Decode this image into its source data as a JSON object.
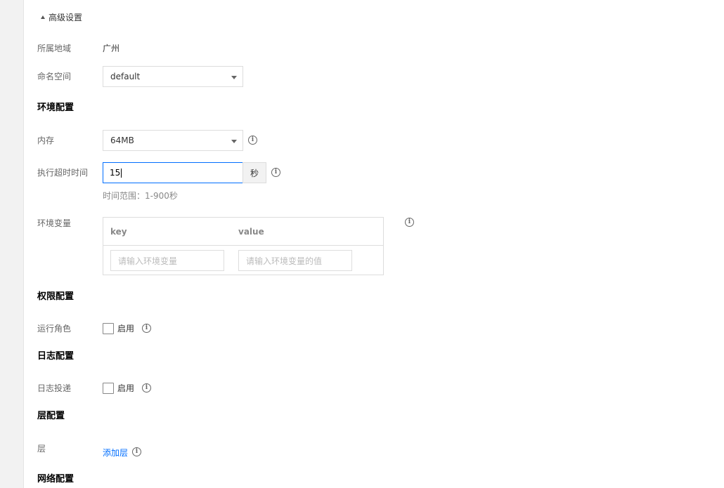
{
  "advanced": {
    "toggle_label": "高级设置"
  },
  "region": {
    "label": "所属地域",
    "value": "广州"
  },
  "namespace": {
    "label": "命名空间",
    "value": "default"
  },
  "env_config": {
    "title": "环境配置",
    "memory": {
      "label": "内存",
      "value": "64MB"
    },
    "timeout": {
      "label": "执行超时时间",
      "value": "15",
      "unit": "秒",
      "hint": "时间范围：1-900秒"
    },
    "env_vars": {
      "label": "环境变量",
      "col_key": "key",
      "col_value": "value",
      "key_placeholder": "请输入环境变量",
      "value_placeholder": "请输入环境变量的值"
    }
  },
  "permission": {
    "title": "权限配置",
    "role_label": "运行角色",
    "enable_label": "启用"
  },
  "log": {
    "title": "日志配置",
    "delivery_label": "日志投递",
    "enable_label": "启用"
  },
  "layer": {
    "title": "层配置",
    "label": "层",
    "add_link": "添加层"
  },
  "network": {
    "title": "网络配置"
  },
  "colors": {
    "link": "#006eff",
    "focus_border": "#006eff",
    "sidebar": "#f2f2f2"
  },
  "icons": {
    "info": "info-icon",
    "toggle": "caret-up-icon",
    "select": "chevron-down-icon"
  }
}
